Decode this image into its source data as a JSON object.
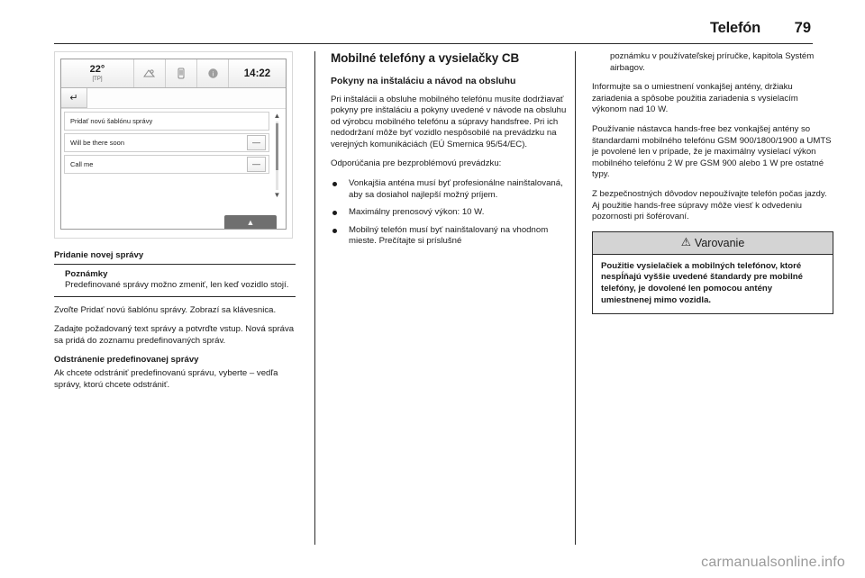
{
  "header": {
    "title": "Telefón",
    "page_number": "79"
  },
  "figure": {
    "status_bar": {
      "temperature": "22°",
      "temp_source": "[TP]",
      "icon_1": "audio-source-icon",
      "icon_2": "phone-icon",
      "icon_3": "info-icon",
      "time": "14:22"
    },
    "back_button_icon": "back-arrow-icon",
    "list_items": [
      {
        "label": "Pridať novú šablónu správy",
        "has_remove": false
      },
      {
        "label": "Will be there soon",
        "has_remove": true,
        "remove_label": "—"
      },
      {
        "label": "Call me",
        "has_remove": true,
        "remove_label": "—"
      }
    ],
    "scroll_up_icon": "chevron-up-icon",
    "scroll_down_icon": "chevron-down-icon",
    "expand_tab_icon": "chevron-up-icon"
  },
  "column1": {
    "heading": "Pridanie novej správy",
    "note": {
      "title": "Poznámky",
      "body": "Predefinované správy možno zmeniť, len keď vozidlo stojí."
    },
    "para_1": "Zvoľte Pridať novú šablónu správy. Zobrazí sa klávesnica.",
    "para_2": "Zadajte požadovaný text správy a potvrďte vstup. Nová správa sa pridá do zoznamu predefinovaných správ.",
    "heading_2": "Odstránenie predefinovanej správy",
    "para_3": "Ak chcete odstrániť predefinovanú správu, vyberte – vedľa správy, ktorú chcete odstrániť."
  },
  "column2": {
    "heading": "Mobilné telefóny a vysielačky CB",
    "subheading": "Pokyny na inštaláciu a návod na obsluhu",
    "para_1": "Pri inštalácii a obsluhe mobilného telefónu musíte dodržiavať pokyny pre inštaláciu a pokyny uvedené v návode na obsluhu od výrobcu mobilného telefónu a súpravy handsfree. Pri ich nedodržaní môže byť vozidlo nespôsobilé na prevádzku na verejných komunikáciách (EÚ Smernica 95/54/EC).",
    "para_2": "Odporúčania pre bezproblémovú prevádzku:",
    "bullets": [
      "Vonkajšia anténa musí byť profesionálne nainštalovaná, aby sa dosiahol najlepší možný príjem.",
      "Maximálny prenosový výkon: 10 W.",
      "Mobilný telefón musí byť nainštalovaný na vhodnom mieste. Prečítajte si príslušné"
    ]
  },
  "column3": {
    "para_cont": "poznámku v používateľskej príručke, kapitola Systém airbagov.",
    "para_1": "Informujte sa o umiestnení vonkajšej antény, držiaku zariadenia a spôsobe použitia zariadenia s vysielacím výkonom nad 10 W.",
    "para_2": "Používanie nástavca hands-free bez vonkajšej antény so štandardami mobilného telefónu GSM 900/1800/1900 a UMTS je povolené len v prípade, že je maximálny vysielací výkon mobilného telefónu 2 W pre GSM 900 alebo 1 W pre ostatné typy.",
    "para_3": "Z bezpečnostných dôvodov nepoužívajte telefón počas jazdy. Aj použitie hands-free súpravy môže viesť k odvedeniu pozornosti pri šoférovaní.",
    "warning": {
      "icon": "warning-triangle-icon",
      "title": "Varovanie",
      "body": "Použitie vysielačiek a mobilných telefónov, ktoré nespĺňajú vyššie uvedené štandardy pre mobilné telefóny, je dovolené len pomocou antény umiestnenej mimo vozidla."
    }
  },
  "footer": {
    "watermark": "carmanualsonline.info"
  }
}
